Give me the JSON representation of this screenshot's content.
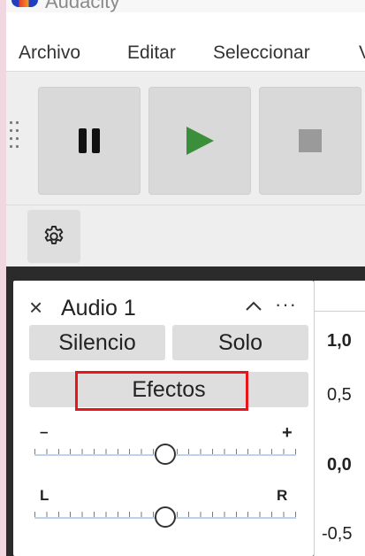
{
  "app": {
    "title": "Audacity"
  },
  "menu": {
    "items": [
      "Archivo",
      "Editar",
      "Seleccionar",
      "V"
    ]
  },
  "toolbar": {
    "buttons": [
      {
        "name": "pause",
        "icon": "pause-icon"
      },
      {
        "name": "play",
        "icon": "play-icon",
        "color": "#3b8f3b"
      },
      {
        "name": "stop",
        "icon": "stop-icon",
        "color": "#9a9a9a"
      }
    ],
    "settings_icon": "gear-icon"
  },
  "track": {
    "name": "Audio 1",
    "close_glyph": "×",
    "menu_glyph": "···",
    "mute_label": "Silencio",
    "solo_label": "Solo",
    "effects_label": "Efectos",
    "highlight_color": "#e8161b",
    "gain": {
      "min_label": "–",
      "max_label": "+",
      "level": 0.5
    },
    "pan": {
      "left_label": "L",
      "right_label": "R",
      "level": 0.5
    }
  },
  "ruler": {
    "labels": [
      "1,0",
      "0,5",
      "0,0",
      "-0,5"
    ]
  }
}
